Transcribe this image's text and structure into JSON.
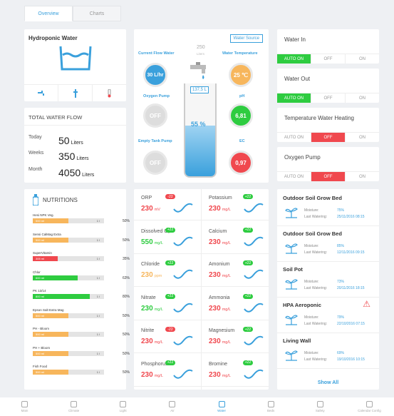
{
  "tabs": [
    "Overview",
    "Charts"
  ],
  "water": {
    "title": "Hydroponic Water"
  },
  "flow": {
    "title": "TOTAL WATER FLOW",
    "rows": [
      {
        "label": "Today",
        "value": "50",
        "unit": "Liters"
      },
      {
        "label": "Weeks",
        "value": "350",
        "unit": "Liters"
      },
      {
        "label": "Month",
        "value": "4050",
        "unit": "Liters"
      }
    ]
  },
  "source": {
    "button": "Water Source",
    "current_label": "Current Flow Water",
    "current_value": "30 L/hr",
    "temp_label": "Water Temperature",
    "temp_value": "25 ℃",
    "oxy_label": "Oxygen Pump",
    "oxy_value": "OFF",
    "ph_label": "pH",
    "ph_value": "6,81",
    "empty_label": "Empty Tank Pump",
    "empty_value": "OFF",
    "ec_label": "EC",
    "ec_value": "0,97",
    "tank_max": "250",
    "tank_unit": "Liters",
    "tank_level": "137,5 L",
    "tank_pct": "55 %",
    "tank_fraction": 0.55
  },
  "controls": [
    {
      "title": "Water In",
      "opts": [
        "AUTO ON",
        "OFF",
        "ON"
      ],
      "active": 0
    },
    {
      "title": "Water Out",
      "opts": [
        "AUTO ON",
        "OFF",
        "ON"
      ],
      "active": 0
    },
    {
      "title": "Temperature Water Heating",
      "opts": [
        "AUTO ON",
        "OFF",
        "ON"
      ],
      "active": 1
    },
    {
      "title": "Oxygen Pump",
      "opts": [
        "AUTO ON",
        "OFF",
        "ON"
      ],
      "active": 1
    }
  ],
  "nutritions": {
    "title": "NUTRITIONS",
    "items": [
      {
        "name": "Hesi NPK Veg.",
        "amount": "500 ml",
        "pct": "50%",
        "fill": 0.5,
        "color": "#f7b65c"
      },
      {
        "name": "Sensi CalMag Extra",
        "amount": "500 ml",
        "pct": "50%",
        "fill": 0.5,
        "color": "#f7b65c"
      },
      {
        "name": "SuperVitamin",
        "amount": "305 ml",
        "pct": "35%",
        "fill": 0.35,
        "color": "#f0484e"
      },
      {
        "name": "Chlor",
        "amount": "600 ml",
        "pct": "63%",
        "fill": 0.63,
        "color": "#2ecc40"
      },
      {
        "name": "PK 13/14",
        "amount": "800 ml",
        "pct": "80%",
        "fill": 0.8,
        "color": "#2ecc40"
      },
      {
        "name": "Epson Salt Extra Mag",
        "amount": "500 ml",
        "pct": "50%",
        "fill": 0.5,
        "color": "#f7b65c"
      },
      {
        "name": "PH - Bloom",
        "amount": "500 ml",
        "pct": "50%",
        "fill": 0.5,
        "color": "#f7b65c"
      },
      {
        "name": "PH + Bloom",
        "amount": "500 ml",
        "pct": "50%",
        "fill": 0.5,
        "color": "#f7b65c"
      },
      {
        "name": "Fish Food",
        "amount": "500 ml",
        "pct": "50%",
        "fill": 0.5,
        "color": "#f7b65c"
      }
    ],
    "x": "1 l"
  },
  "chem": [
    {
      "name": "ORP",
      "value": "230",
      "unit": "mV",
      "badge": "-22",
      "bc": "#f0484e",
      "vc": "#f0484e"
    },
    {
      "name": "Potassium",
      "value": "230",
      "unit": "mg/L",
      "badge": "+22",
      "bc": "#2ecc40",
      "vc": "#f0484e"
    },
    {
      "name": "Dissolved O₂",
      "value": "550",
      "unit": "mg/L",
      "badge": "+22",
      "bc": "#2ecc40",
      "vc": "#2ecc40"
    },
    {
      "name": "Calcium",
      "value": "230",
      "unit": "mg/L",
      "badge": "+22",
      "bc": "#2ecc40",
      "vc": "#f0484e"
    },
    {
      "name": "Chloride",
      "value": "230",
      "unit": "ppm",
      "badge": "+22",
      "bc": "#2ecc40",
      "vc": "#f7b65c"
    },
    {
      "name": "Amonium",
      "value": "230",
      "unit": "mg/L",
      "badge": "+22",
      "bc": "#2ecc40",
      "vc": "#f0484e"
    },
    {
      "name": "Nitrate",
      "value": "230",
      "unit": "mg/L",
      "badge": "+22",
      "bc": "#2ecc40",
      "vc": "#2ecc40"
    },
    {
      "name": "Ammonia",
      "value": "230",
      "unit": "mg/L",
      "badge": "+22",
      "bc": "#2ecc40",
      "vc": "#f0484e"
    },
    {
      "name": "Nitrite",
      "value": "230",
      "unit": "mg/L",
      "badge": "-22",
      "bc": "#f0484e",
      "vc": "#f0484e"
    },
    {
      "name": "Magnesium",
      "value": "230",
      "unit": "mg/L",
      "badge": "+22",
      "bc": "#2ecc40",
      "vc": "#f0484e"
    },
    {
      "name": "Phosphorus",
      "value": "230",
      "unit": "mg/L",
      "badge": "+22",
      "bc": "#2ecc40",
      "vc": "#f0484e"
    },
    {
      "name": "Bromine",
      "value": "230",
      "unit": "mg/L",
      "badge": "+22",
      "bc": "#2ecc40",
      "vc": "#f0484e"
    }
  ],
  "soil": {
    "moisture_label": "Moisture:",
    "watering_label": "Last Watering:",
    "items": [
      {
        "title": "Outdoor Soil Grow Bed",
        "moisture": "75%",
        "watering": "25/11/2016 08:15"
      },
      {
        "title": "Outdoor Soil Grow Bed",
        "moisture": "85%",
        "watering": "12/11/2016 09:15"
      },
      {
        "title": "Soil Pot",
        "moisture": "73%",
        "watering": "20/11/2016 18:15"
      },
      {
        "title": "HPA Aeroponic",
        "moisture": "79%",
        "watering": "22/10/2016 07:15"
      },
      {
        "title": "Living Wall",
        "moisture": "69%",
        "watering": "19/10/2016 10:15"
      }
    ],
    "show_all": "Show All"
  },
  "nav": [
    {
      "label": "Main",
      "icon": "home-icon"
    },
    {
      "label": "Climate",
      "icon": "thermometer-icon"
    },
    {
      "label": "Light",
      "icon": "bulb-icon"
    },
    {
      "label": "Air",
      "icon": "air-icon"
    },
    {
      "label": "Water",
      "icon": "water-icon",
      "active": true
    },
    {
      "label": "Beds",
      "icon": "beds-icon"
    },
    {
      "label": "Safety",
      "icon": "warning-icon"
    },
    {
      "label": "Calendar Config",
      "icon": "calendar-icon"
    }
  ]
}
